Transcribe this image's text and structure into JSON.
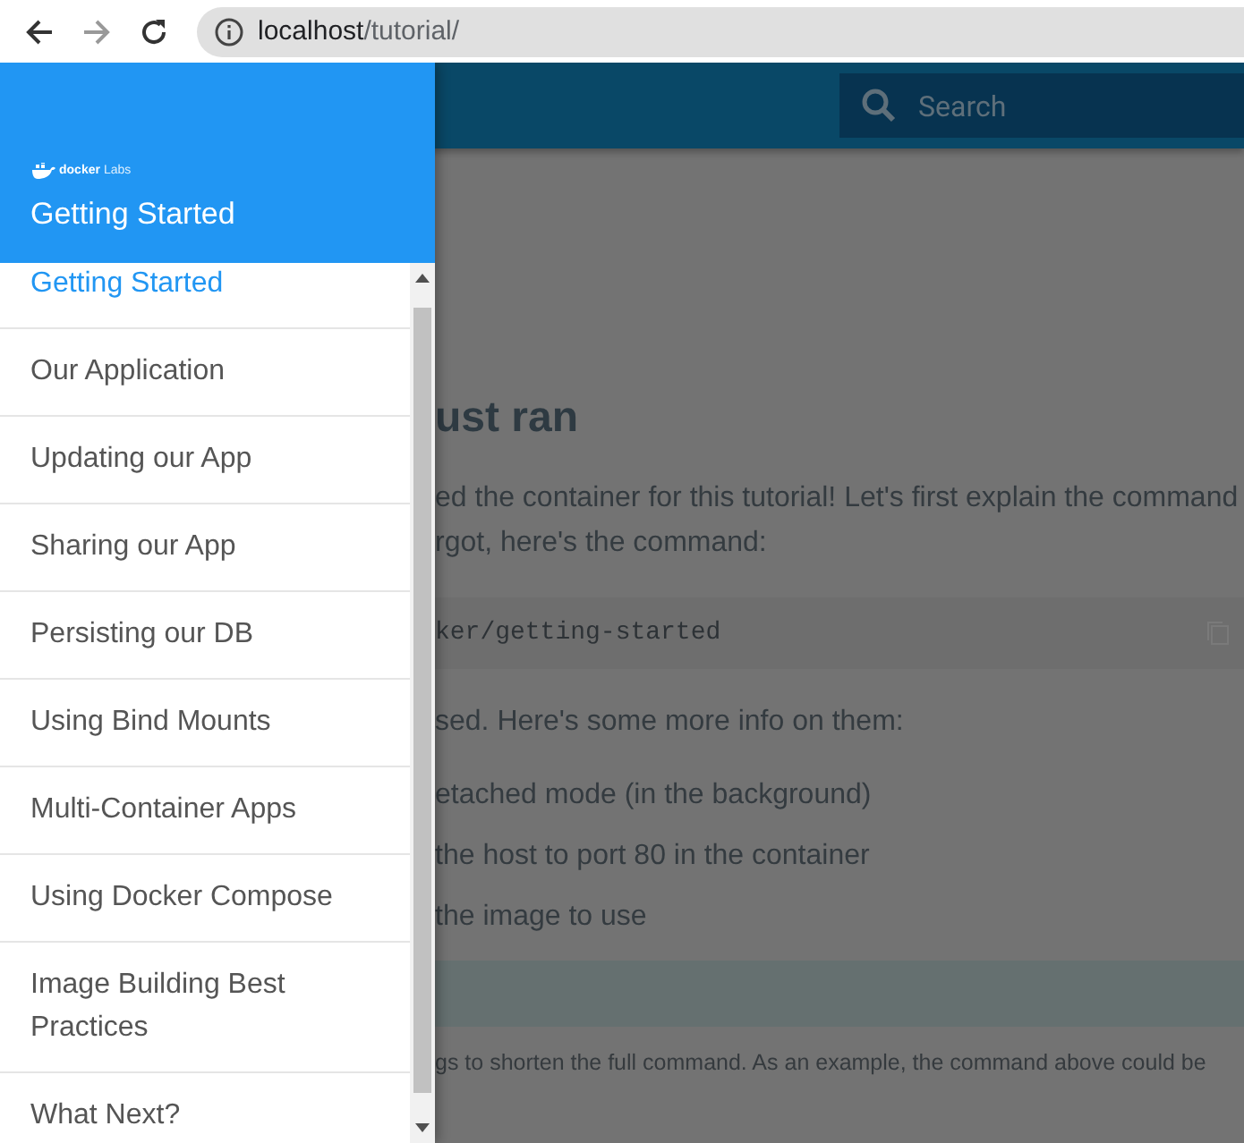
{
  "browser": {
    "back_enabled": true,
    "forward_enabled": false,
    "url_host": "localhost",
    "url_path": "/tutorial/"
  },
  "header": {
    "search": {
      "placeholder": "Search"
    }
  },
  "drawer": {
    "logo_text": "docker",
    "logo_sub": "Labs",
    "title": "Getting Started",
    "items": [
      {
        "label": "Getting Started",
        "selected": true
      },
      {
        "label": "Our Application",
        "selected": false
      },
      {
        "label": "Updating our App",
        "selected": false
      },
      {
        "label": "Sharing our App",
        "selected": false
      },
      {
        "label": "Persisting our DB",
        "selected": false
      },
      {
        "label": "Using Bind Mounts",
        "selected": false
      },
      {
        "label": "Multi-Container Apps",
        "selected": false
      },
      {
        "label": "Using Docker Compose",
        "selected": false
      },
      {
        "label": "Image Building Best Practices",
        "selected": false
      },
      {
        "label": "What Next?",
        "selected": false
      }
    ]
  },
  "content": {
    "heading": "ust ran",
    "paragraph_lines": [
      "ed the container for this tutorial! Let's first explain the command",
      "rgot, here's the command:"
    ],
    "code": "ker/getting-started",
    "intro": "sed. Here's some more info on them:",
    "list": [
      "etached mode (in the background)",
      "the host to port 80 in the container",
      "the image to use"
    ],
    "note": "gs to shorten the full command. As an example, the command above could be"
  }
}
